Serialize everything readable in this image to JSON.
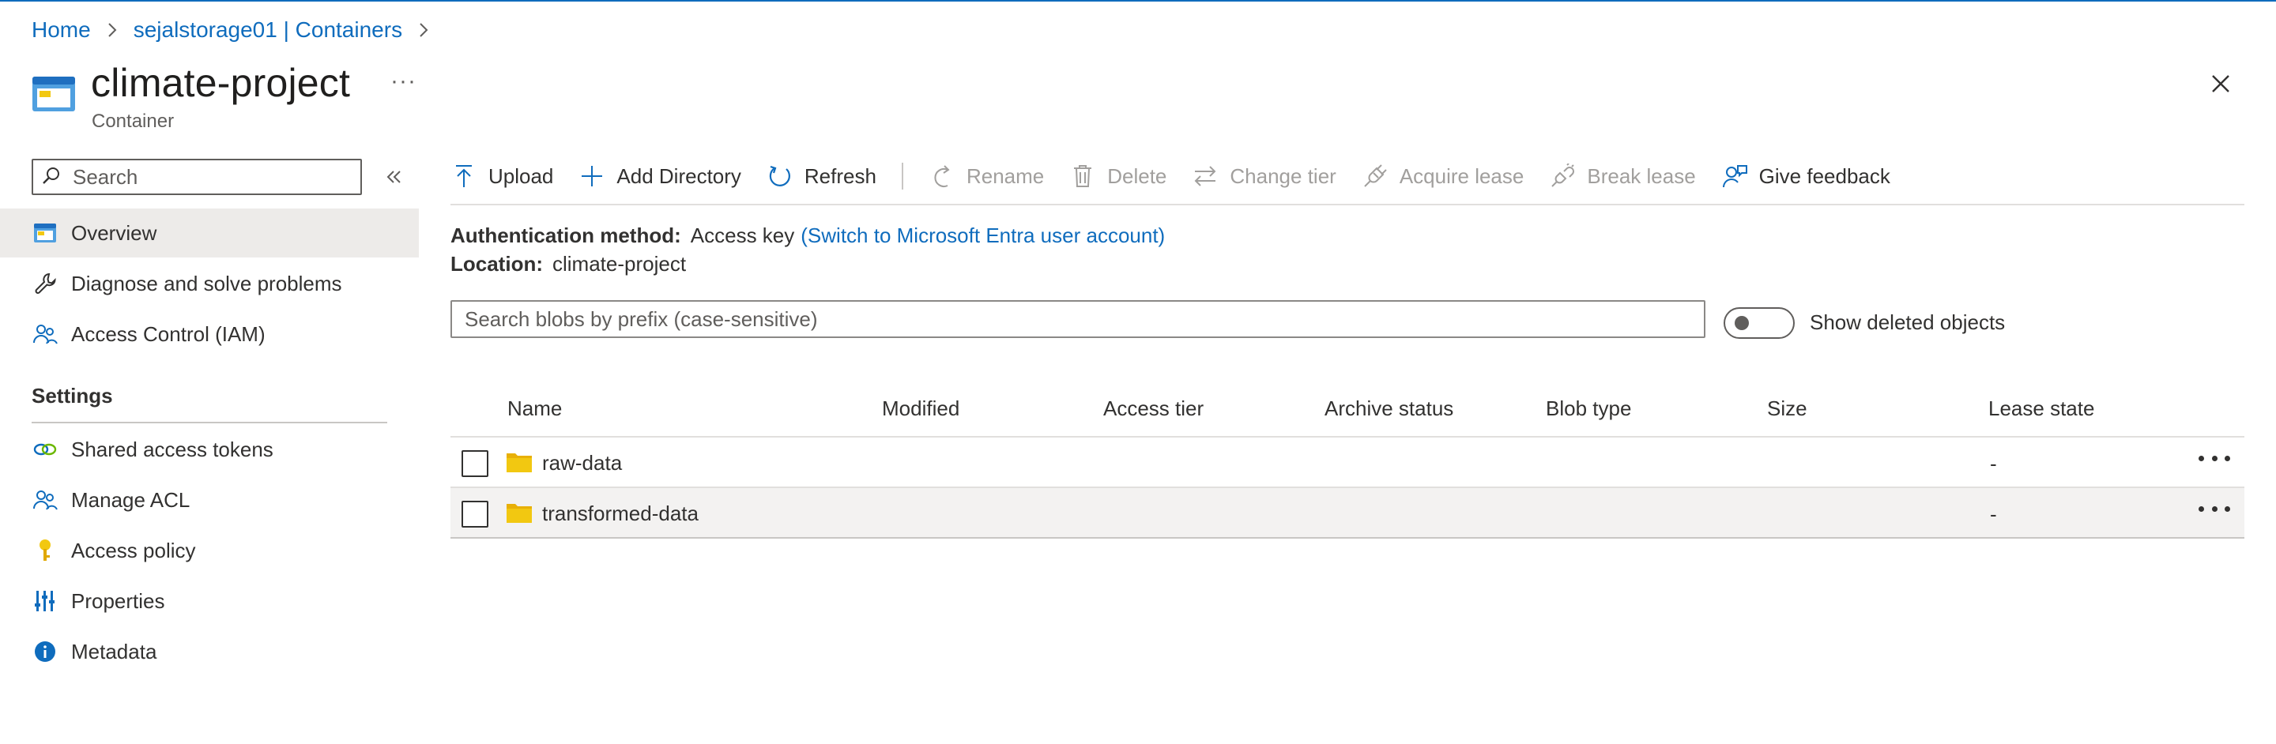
{
  "breadcrumb": [
    {
      "label": "Home"
    },
    {
      "label": "sejalstorage01 | Containers"
    }
  ],
  "header": {
    "title": "climate-project",
    "subtitle": "Container",
    "more": "···"
  },
  "sidebar": {
    "search_placeholder": "Search",
    "items": [
      {
        "label": "Overview",
        "icon": "container-icon"
      },
      {
        "label": "Diagnose and solve problems",
        "icon": "wrench-icon"
      },
      {
        "label": "Access Control (IAM)",
        "icon": "people-icon"
      }
    ],
    "settings_heading": "Settings",
    "settings_items": [
      {
        "label": "Shared access tokens",
        "icon": "link-icon"
      },
      {
        "label": "Manage ACL",
        "icon": "people-icon"
      },
      {
        "label": "Access policy",
        "icon": "key-icon"
      },
      {
        "label": "Properties",
        "icon": "properties-icon"
      },
      {
        "label": "Metadata",
        "icon": "info-icon"
      }
    ]
  },
  "toolbar": {
    "upload": "Upload",
    "add_directory": "Add Directory",
    "refresh": "Refresh",
    "rename": "Rename",
    "delete": "Delete",
    "change_tier": "Change tier",
    "acquire_lease": "Acquire lease",
    "break_lease": "Break lease",
    "give_feedback": "Give feedback"
  },
  "info": {
    "auth_label": "Authentication method:",
    "auth_value": "Access key",
    "auth_link": "(Switch to Microsoft Entra user account)",
    "location_label": "Location:",
    "location_value": "climate-project"
  },
  "blob_search": {
    "placeholder": "Search blobs by prefix (case-sensitive)"
  },
  "show_deleted": {
    "label": "Show deleted objects",
    "on": false
  },
  "table": {
    "columns": [
      "Name",
      "Modified",
      "Access tier",
      "Archive status",
      "Blob type",
      "Size",
      "Lease state"
    ],
    "rows": [
      {
        "name": "raw-data",
        "lease_state": "-"
      },
      {
        "name": "transformed-data",
        "lease_state": "-"
      }
    ]
  },
  "colors": {
    "accent": "#0f6cbd",
    "folder": "#f2c811",
    "selected_bg": "#edebe9"
  }
}
